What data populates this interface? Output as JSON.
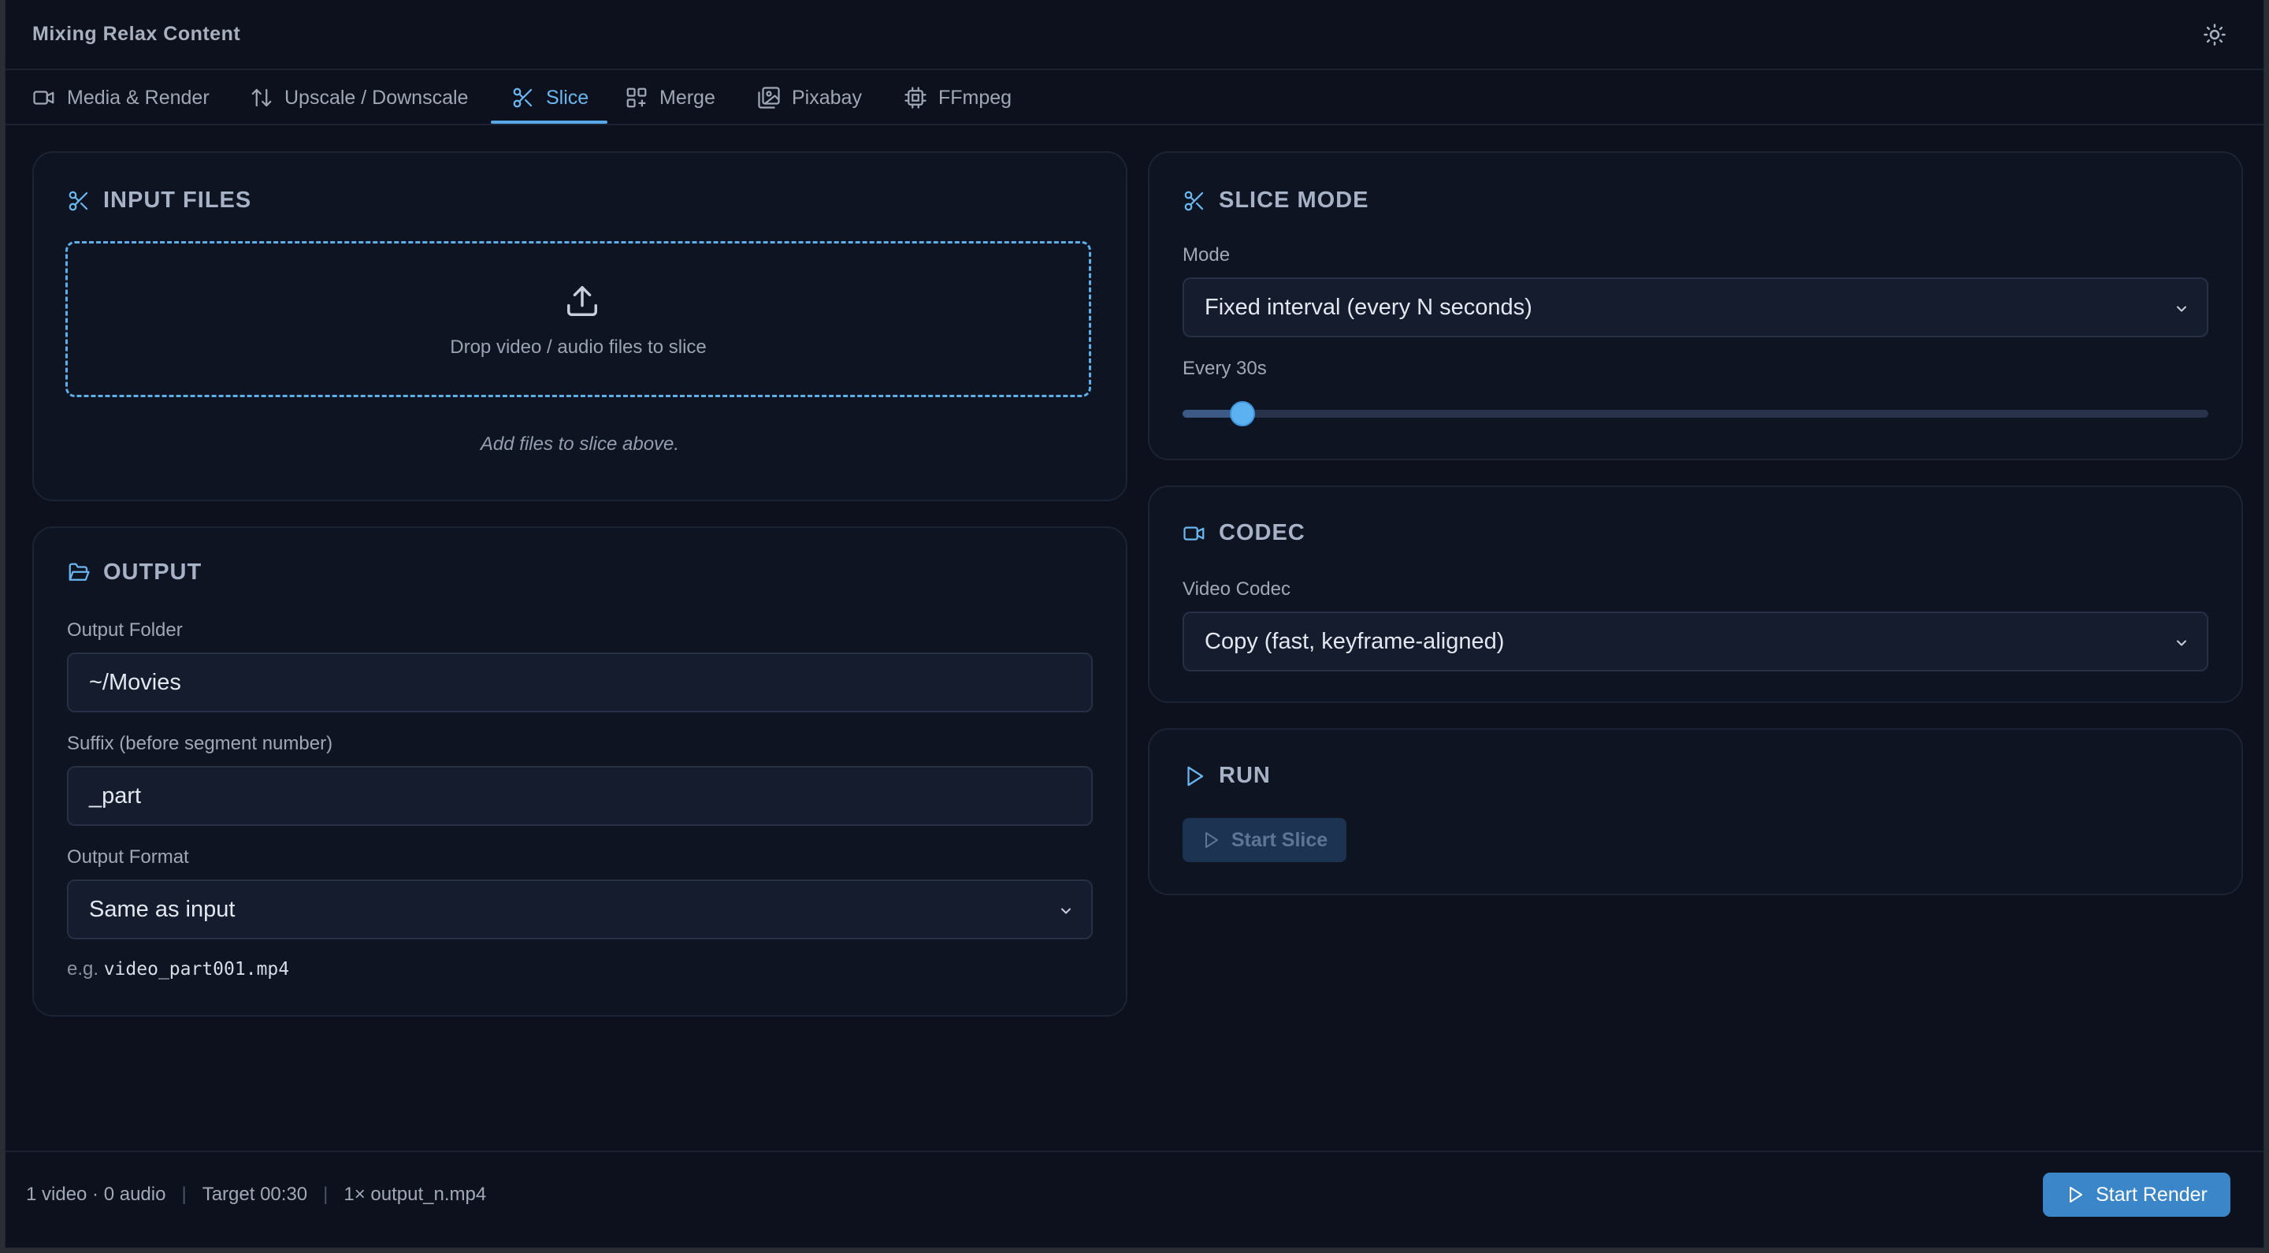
{
  "app": {
    "title": "Mixing Relax Content"
  },
  "header": {
    "theme_icon": "sun-icon"
  },
  "tabs": [
    {
      "label": "Media & Render",
      "icon": "video-camera-icon"
    },
    {
      "label": "Upscale / Downscale",
      "icon": "arrows-up-down-icon"
    },
    {
      "label": "Slice",
      "icon": "scissors-icon",
      "active": true
    },
    {
      "label": "Merge",
      "icon": "merge-icon"
    },
    {
      "label": "Pixabay",
      "icon": "images-icon"
    },
    {
      "label": "FFmpeg",
      "icon": "chip-icon"
    }
  ],
  "input_files": {
    "title": "INPUT FILES",
    "drop_text": "Drop video / audio files to slice",
    "empty_hint": "Add files to slice above."
  },
  "output": {
    "title": "OUTPUT",
    "folder_label": "Output Folder",
    "folder_value": "~/Movies",
    "suffix_label": "Suffix (before segment number)",
    "suffix_value": "_part",
    "format_label": "Output Format",
    "format_value": "Same as input",
    "example_prefix": "e.g.",
    "example_file": "video_part001.mp4"
  },
  "slice_mode": {
    "title": "SLICE MODE",
    "mode_label": "Mode",
    "mode_value": "Fixed interval (every N seconds)",
    "interval_label": "Every 30s",
    "slider_fraction": 0.058
  },
  "codec": {
    "title": "CODEC",
    "video_codec_label": "Video Codec",
    "video_codec_value": "Copy (fast, keyframe-aligned)"
  },
  "run": {
    "title": "RUN",
    "start_slice_label": "Start Slice"
  },
  "footer": {
    "media_count": "1 video · 0 audio",
    "target": "Target 00:30",
    "output_summary": "1× output_n.mp4",
    "start_render_label": "Start Render"
  },
  "colors": {
    "accent": "#56a8e8",
    "background": "#0c111d",
    "card": "#0e1422",
    "primary_button": "#3a86c9"
  }
}
